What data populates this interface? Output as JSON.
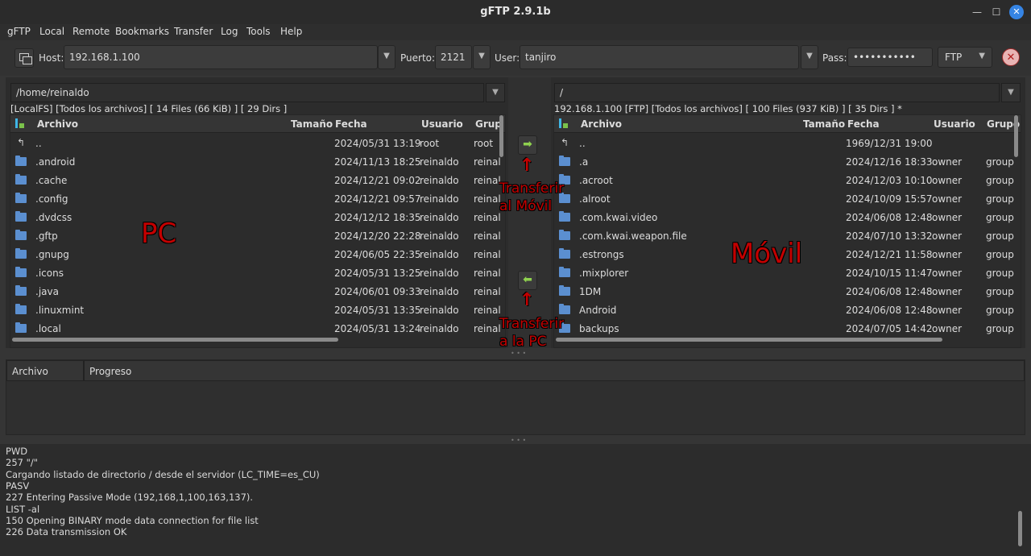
{
  "window": {
    "title": "gFTP 2.9.1b"
  },
  "menu": [
    "gFTP",
    "Local",
    "Remote",
    "Bookmarks",
    "Transfer",
    "Log",
    "Tools",
    "Help"
  ],
  "toolbar": {
    "host_label": "Host:",
    "host_value": "192.168.1.100",
    "port_label": "Puerto:",
    "port_value": "2121",
    "user_label": "User:",
    "user_value": "tanjiro",
    "pass_label": "Pass:",
    "pass_value": "•••••••••••",
    "protocol": "FTP"
  },
  "local": {
    "path": "/home/reinaldo",
    "status": "[LocalFS] [Todos los archivos] [ 14 Files (66 KiB) ]  [ 29 Dirs ]",
    "columns": {
      "name": "Archivo",
      "size": "Tamaño",
      "date": "Fecha",
      "user": "Usuario",
      "group": "Grup"
    },
    "rows": [
      {
        "name": "..",
        "date": "2024/05/31 13:19",
        "user": "root",
        "group": "root"
      },
      {
        "name": ".android",
        "date": "2024/11/13 18:25",
        "user": "reinaldo",
        "group": "reinal"
      },
      {
        "name": ".cache",
        "date": "2024/12/21 09:02",
        "user": "reinaldo",
        "group": "reinal"
      },
      {
        "name": ".config",
        "date": "2024/12/21 09:57",
        "user": "reinaldo",
        "group": "reinal"
      },
      {
        "name": ".dvdcss",
        "date": "2024/12/12 18:35",
        "user": "reinaldo",
        "group": "reinal"
      },
      {
        "name": ".gftp",
        "date": "2024/12/20 22:28",
        "user": "reinaldo",
        "group": "reinal"
      },
      {
        "name": ".gnupg",
        "date": "2024/06/05 22:35",
        "user": "reinaldo",
        "group": "reinal"
      },
      {
        "name": ".icons",
        "date": "2024/05/31 13:25",
        "user": "reinaldo",
        "group": "reinal"
      },
      {
        "name": ".java",
        "date": "2024/06/01 09:33",
        "user": "reinaldo",
        "group": "reinal"
      },
      {
        "name": ".linuxmint",
        "date": "2024/05/31 13:35",
        "user": "reinaldo",
        "group": "reinal"
      },
      {
        "name": ".local",
        "date": "2024/05/31 13:24",
        "user": "reinaldo",
        "group": "reinal"
      }
    ]
  },
  "remote": {
    "path": "/",
    "status": "192.168.1.100 [FTP] [Todos los archivos] [ 100 Files (937 KiB) ]  [ 35 Dirs ] *",
    "columns": {
      "name": "Archivo",
      "size": "Tamaño",
      "date": "Fecha",
      "user": "Usuario",
      "group": "Grupo"
    },
    "rows": [
      {
        "name": "..",
        "date": "1969/12/31 19:00",
        "user": "",
        "group": ""
      },
      {
        "name": ".a",
        "date": "2024/12/16 18:33",
        "user": "owner",
        "group": "group"
      },
      {
        "name": ".acroot",
        "date": "2024/12/03 10:10",
        "user": "owner",
        "group": "group"
      },
      {
        "name": ".alroot",
        "date": "2024/10/09 15:57",
        "user": "owner",
        "group": "group"
      },
      {
        "name": ".com.kwai.video",
        "date": "2024/06/08 12:48",
        "user": "owner",
        "group": "group"
      },
      {
        "name": ".com.kwai.weapon.file",
        "date": "2024/07/10 13:32",
        "user": "owner",
        "group": "group"
      },
      {
        "name": ".estrongs",
        "date": "2024/12/21 11:58",
        "user": "owner",
        "group": "group"
      },
      {
        "name": ".mixplorer",
        "date": "2024/10/15 11:47",
        "user": "owner",
        "group": "group"
      },
      {
        "name": "1DM",
        "date": "2024/06/08 12:48",
        "user": "owner",
        "group": "group"
      },
      {
        "name": "Android",
        "date": "2024/06/08 12:48",
        "user": "owner",
        "group": "group"
      },
      {
        "name": "backups",
        "date": "2024/07/05 14:42",
        "user": "owner",
        "group": "group"
      }
    ]
  },
  "transfer": {
    "col_file": "Archivo",
    "col_progress": "Progreso"
  },
  "log": [
    "PWD",
    "257 \"/\"",
    "Cargando listado de directorio / desde el servidor (LC_TIME=es_CU)",
    "PASV",
    "227 Entering Passive Mode (192,168,1,100,163,137).",
    "LIST -al",
    "150 Opening BINARY mode data connection for file list",
    "226 Data transmission OK"
  ],
  "annotations": {
    "pc": "PC",
    "movil": "Móvil",
    "to_mobile_1": "Transferir",
    "to_mobile_2": "al Móvil",
    "to_pc_1": "Transferir",
    "to_pc_2": "a la PC"
  }
}
